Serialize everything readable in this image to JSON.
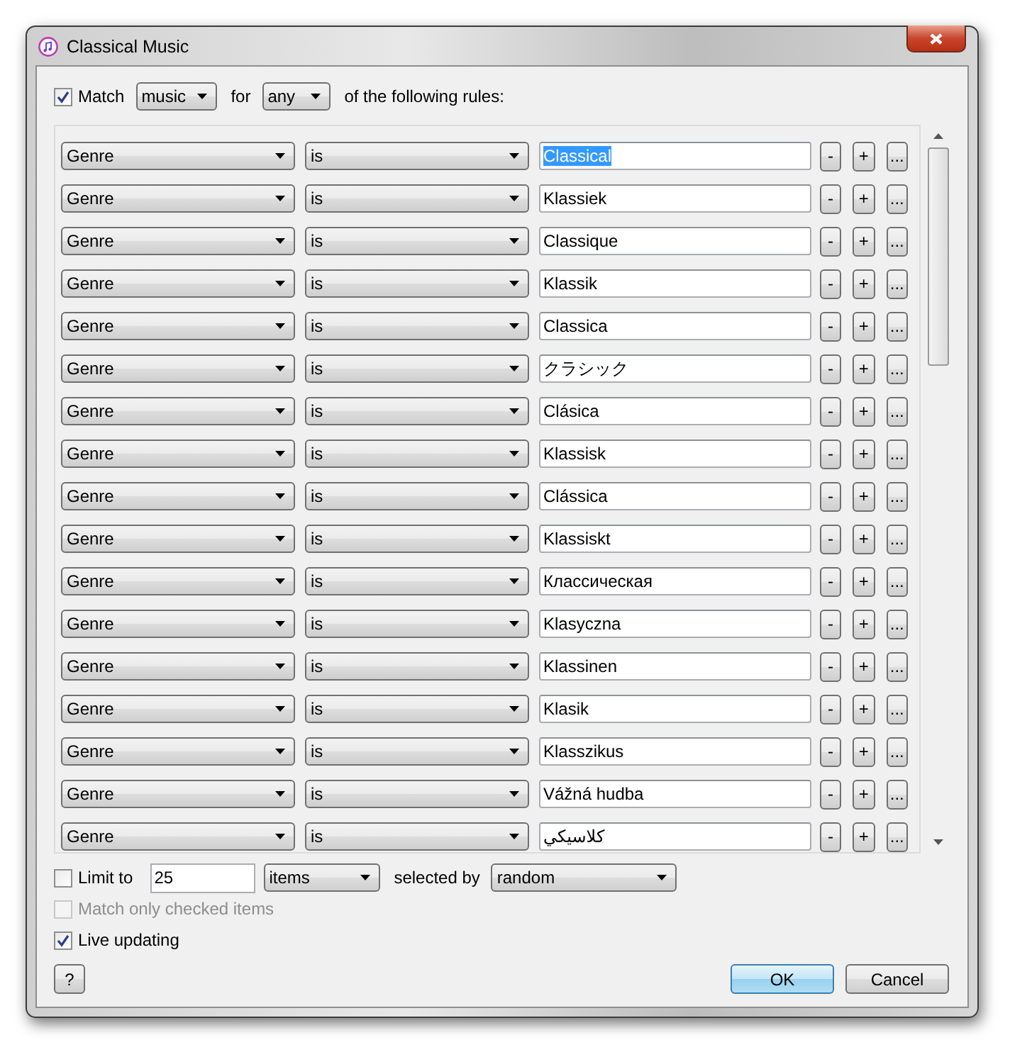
{
  "window": {
    "title": "Classical Music"
  },
  "match": {
    "checked": true,
    "label": "Match",
    "kind": "music",
    "for_label": "for",
    "quantifier": "any",
    "suffix": "of the following rules:"
  },
  "rules": [
    {
      "field": "Genre",
      "operator": "is",
      "value": "Classical",
      "highlighted": true,
      "buttons": [
        "-",
        "+",
        "..."
      ]
    },
    {
      "field": "Genre",
      "operator": "is",
      "value": "Klassiek",
      "highlighted": false,
      "buttons": [
        "-",
        "+",
        "..."
      ]
    },
    {
      "field": "Genre",
      "operator": "is",
      "value": "Classique",
      "highlighted": false,
      "buttons": [
        "-",
        "+",
        "..."
      ]
    },
    {
      "field": "Genre",
      "operator": "is",
      "value": "Klassik",
      "highlighted": false,
      "buttons": [
        "-",
        "+",
        "..."
      ]
    },
    {
      "field": "Genre",
      "operator": "is",
      "value": "Classica",
      "highlighted": false,
      "buttons": [
        "-",
        "+",
        "..."
      ]
    },
    {
      "field": "Genre",
      "operator": "is",
      "value": "クラシック",
      "highlighted": false,
      "buttons": [
        "-",
        "+",
        "..."
      ]
    },
    {
      "field": "Genre",
      "operator": "is",
      "value": "Clásica",
      "highlighted": false,
      "buttons": [
        "-",
        "+",
        "..."
      ]
    },
    {
      "field": "Genre",
      "operator": "is",
      "value": "Klassisk",
      "highlighted": false,
      "buttons": [
        "-",
        "+",
        "..."
      ]
    },
    {
      "field": "Genre",
      "operator": "is",
      "value": "Clássica",
      "highlighted": false,
      "buttons": [
        "-",
        "+",
        "..."
      ]
    },
    {
      "field": "Genre",
      "operator": "is",
      "value": "Klassiskt",
      "highlighted": false,
      "buttons": [
        "-",
        "+",
        "..."
      ]
    },
    {
      "field": "Genre",
      "operator": "is",
      "value": "Классическая",
      "highlighted": false,
      "buttons": [
        "-",
        "+",
        "..."
      ]
    },
    {
      "field": "Genre",
      "operator": "is",
      "value": "Klasyczna",
      "highlighted": false,
      "buttons": [
        "-",
        "+",
        "..."
      ]
    },
    {
      "field": "Genre",
      "operator": "is",
      "value": "Klassinen",
      "highlighted": false,
      "buttons": [
        "-",
        "+",
        "..."
      ]
    },
    {
      "field": "Genre",
      "operator": "is",
      "value": "Klasik",
      "highlighted": false,
      "buttons": [
        "-",
        "+",
        "..."
      ]
    },
    {
      "field": "Genre",
      "operator": "is",
      "value": "Klasszikus",
      "highlighted": false,
      "buttons": [
        "-",
        "+",
        "..."
      ]
    },
    {
      "field": "Genre",
      "operator": "is",
      "value": "Vážná hudba",
      "highlighted": false,
      "buttons": [
        "-",
        "+",
        "..."
      ]
    },
    {
      "field": "Genre",
      "operator": "is",
      "value": "كلاسيكي",
      "highlighted": false,
      "buttons": [
        "-",
        "+",
        "..."
      ]
    }
  ],
  "limit": {
    "checked": false,
    "label": "Limit to",
    "value": "25",
    "unit": "items",
    "selected_by_label": "selected by",
    "selected_by": "random"
  },
  "match_only_checked": {
    "checked": false,
    "disabled": true,
    "label": "Match only checked items"
  },
  "live_updating": {
    "checked": true,
    "disabled": false,
    "label": "Live updating"
  },
  "buttons": {
    "help": "?",
    "ok": "OK",
    "cancel": "Cancel"
  }
}
